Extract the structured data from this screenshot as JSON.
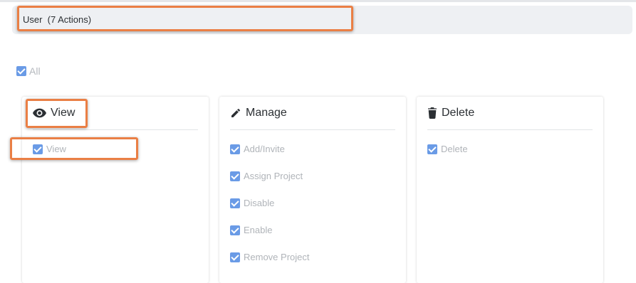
{
  "section": {
    "title": "User  (7 Actions)"
  },
  "all": {
    "label": "All",
    "checked": true
  },
  "cards": [
    {
      "title": "View",
      "icon": "eye-icon",
      "options": [
        {
          "label": "View",
          "checked": true
        }
      ]
    },
    {
      "title": "Manage",
      "icon": "pencil-icon",
      "options": [
        {
          "label": "Add/Invite",
          "checked": true
        },
        {
          "label": "Assign Project",
          "checked": true
        },
        {
          "label": "Disable",
          "checked": true
        },
        {
          "label": "Enable",
          "checked": true
        },
        {
          "label": "Remove Project",
          "checked": true
        }
      ]
    },
    {
      "title": "Delete",
      "icon": "trash-icon",
      "options": [
        {
          "label": "Delete",
          "checked": true
        }
      ]
    }
  ],
  "colors": {
    "checkbox": "#6a9be6",
    "highlight": "#ea7f45",
    "header_bg": "#eef0f3"
  }
}
